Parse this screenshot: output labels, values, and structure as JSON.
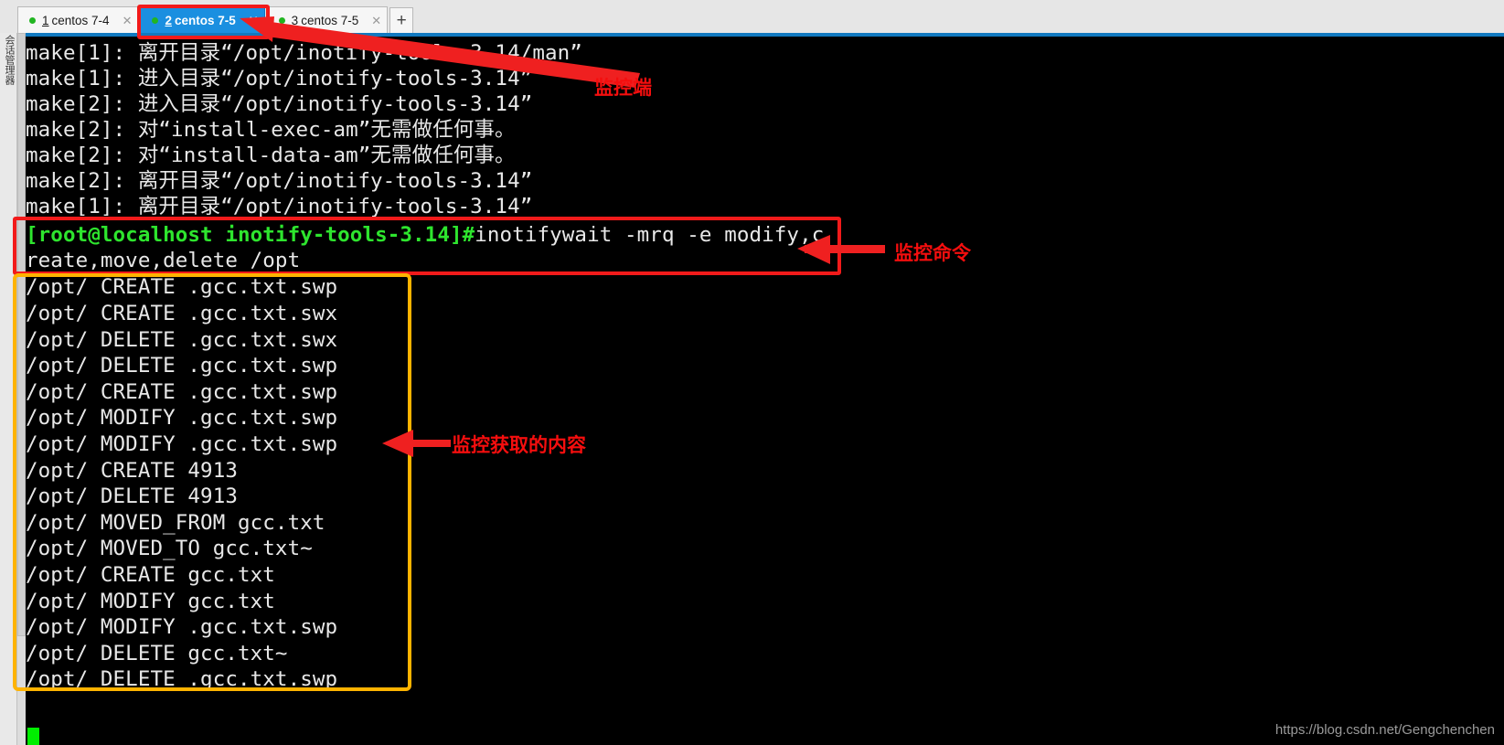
{
  "window": {
    "sidebar_vertical_label": "会话管理器"
  },
  "tabs": {
    "items": [
      {
        "number": "1",
        "title": "centos 7-4",
        "active": false,
        "status_dot": "green",
        "close_glyph": "✕"
      },
      {
        "number": "2",
        "title": "centos 7-5",
        "active": true,
        "status_dot": "green",
        "close_glyph": "✕"
      },
      {
        "number": "3",
        "title": "centos 7-5",
        "active": false,
        "status_dot": "green",
        "close_glyph": "✕"
      }
    ],
    "new_tab_label": "+"
  },
  "terminal": {
    "make_lines": [
      "make[1]: 离开目录“/opt/inotify-tools-3.14/man”",
      "make[1]: 进入目录“/opt/inotify-tools-3.14”",
      "make[2]: 进入目录“/opt/inotify-tools-3.14”",
      "make[2]: 对“install-exec-am”无需做任何事。",
      "make[2]: 对“install-data-am”无需做任何事。",
      "make[2]: 离开目录“/opt/inotify-tools-3.14”",
      "make[1]: 离开目录“/opt/inotify-tools-3.14”"
    ],
    "prompt": "[root@localhost inotify-tools-3.14]#",
    "command_part1": "inotifywait -mrq -e modify,c",
    "command_part2": "reate,move,delete /opt",
    "output_lines": [
      "/opt/ CREATE .gcc.txt.swp",
      "/opt/ CREATE .gcc.txt.swx",
      "/opt/ DELETE .gcc.txt.swx",
      "/opt/ DELETE .gcc.txt.swp",
      "/opt/ CREATE .gcc.txt.swp",
      "/opt/ MODIFY .gcc.txt.swp",
      "/opt/ MODIFY .gcc.txt.swp",
      "/opt/ CREATE 4913",
      "/opt/ DELETE 4913",
      "/opt/ MOVED_FROM gcc.txt",
      "/opt/ MOVED_TO gcc.txt~",
      "/opt/ CREATE gcc.txt",
      "/opt/ MODIFY gcc.txt",
      "/opt/ MODIFY .gcc.txt.swp",
      "/opt/ DELETE gcc.txt~",
      "/opt/ DELETE .gcc.txt.swp"
    ]
  },
  "annotations": {
    "tab_label": "监控端",
    "command_label": "监控命令",
    "output_label": "监控获取的内容",
    "colors": {
      "highlight_red": "#f21a1a",
      "highlight_orange": "#ffb300",
      "text_red": "#f50e0e",
      "prompt_green": "#2ee52e",
      "tab_active_blue": "#1a8fe0"
    }
  },
  "watermark": {
    "text": "https://blog.csdn.net/Gengchenchen"
  }
}
